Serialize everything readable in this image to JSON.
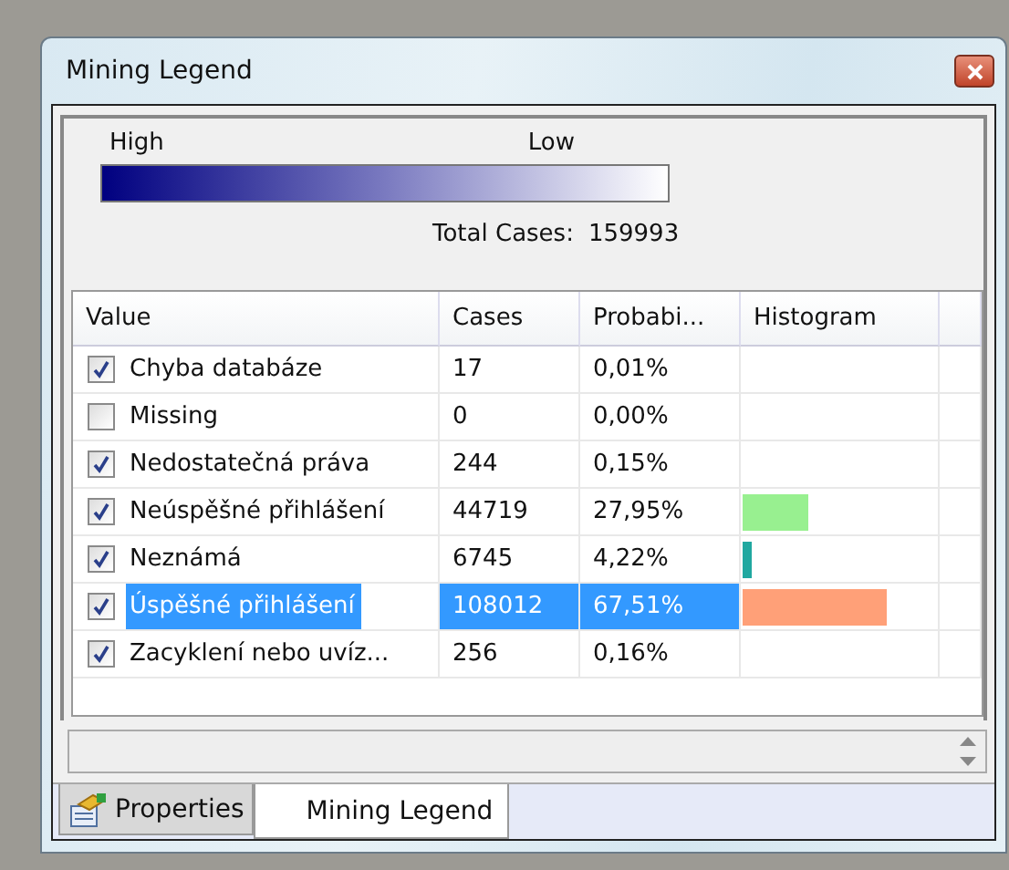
{
  "window": {
    "title": "Mining Legend"
  },
  "legend": {
    "high_label": "High",
    "low_label": "Low",
    "total_label": "Total Cases:",
    "total_value": "159993"
  },
  "table": {
    "columns": [
      "Value",
      "Cases",
      "Probabi...",
      "Histogram"
    ],
    "rows": [
      {
        "value": "Chyba databáze",
        "cases": "17",
        "probability": "0,01%",
        "checked": true,
        "selected": false
      },
      {
        "value": "Missing",
        "cases": "0",
        "probability": "0,00%",
        "checked": false,
        "selected": false
      },
      {
        "value": "Nedostatečná práva",
        "cases": "244",
        "probability": "0,15%",
        "checked": true,
        "selected": false
      },
      {
        "value": "Neúspěšné přihlášení",
        "cases": "44719",
        "probability": "27,95%",
        "checked": true,
        "selected": false,
        "level": 0.34,
        "color": "#98f090"
      },
      {
        "value": "Neznámá",
        "cases": "6745",
        "probability": "4,22%",
        "checked": true,
        "selected": false,
        "level": 0.05,
        "color": "#20a8a0"
      },
      {
        "value": "Úspěšné přihlášení",
        "cases": "108012",
        "probability": "67,51%",
        "checked": true,
        "selected": true,
        "level": 0.74,
        "color": "#ffa078"
      },
      {
        "value": "Zacyklení nebo uvíz...",
        "cases": "256",
        "probability": "0,16%",
        "checked": true,
        "selected": false
      }
    ]
  },
  "tabs": [
    {
      "label": "Properties",
      "selected": false
    },
    {
      "label": "Mining Legend",
      "selected": true
    }
  ]
}
